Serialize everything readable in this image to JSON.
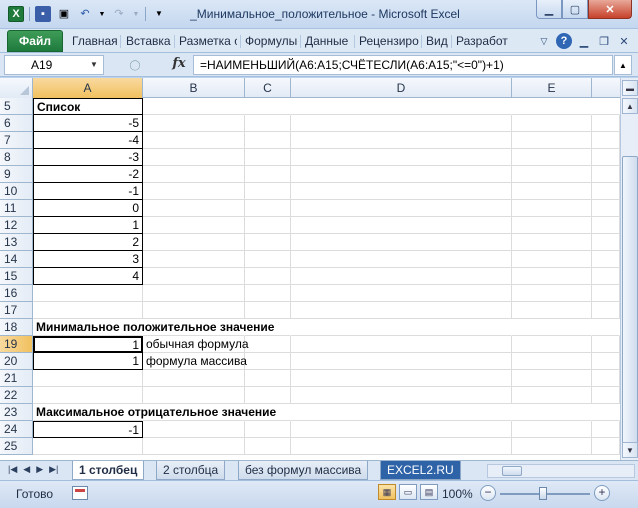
{
  "window": {
    "title": "_Минимальное_положительное  -  Microsoft Excel",
    "icons": [
      "excel-logo",
      "save",
      "save-as",
      "undo",
      "redo",
      "customize-qat"
    ]
  },
  "ribbon": {
    "file_tab": "Файл",
    "tabs": [
      "Главная",
      "Вставка",
      "Разметка с",
      "Формулы",
      "Данные",
      "Рецензиро",
      "Вид",
      "Разработ"
    ]
  },
  "formula_bar": {
    "name_box": "A19",
    "fx": "fx",
    "formula": "=НАИМЕНЬШИЙ(A6:A15;СЧЁТЕСЛИ(A6:A15;\"<=0\")+1)"
  },
  "grid": {
    "columns": [
      "A",
      "B",
      "C",
      "D",
      "E"
    ],
    "selected_column": "A",
    "selected_row": "19",
    "rows": [
      {
        "n": "5",
        "a": "Список",
        "a_bold": true
      },
      {
        "n": "6",
        "a": "-5"
      },
      {
        "n": "7",
        "a": "-4"
      },
      {
        "n": "8",
        "a": "-3"
      },
      {
        "n": "9",
        "a": "-2"
      },
      {
        "n": "10",
        "a": "-1"
      },
      {
        "n": "11",
        "a": "0"
      },
      {
        "n": "12",
        "a": "1"
      },
      {
        "n": "13",
        "a": "2"
      },
      {
        "n": "14",
        "a": "3"
      },
      {
        "n": "15",
        "a": "4"
      },
      {
        "n": "16",
        "a": ""
      },
      {
        "n": "17",
        "a": ""
      },
      {
        "n": "18",
        "a": "Минимальное положительное значение",
        "a_bold": true
      },
      {
        "n": "19",
        "a": "1",
        "b": "обычная формула"
      },
      {
        "n": "20",
        "a": "1",
        "b": "формула массива"
      },
      {
        "n": "21",
        "a": ""
      },
      {
        "n": "22",
        "a": ""
      },
      {
        "n": "23",
        "a": "Максимальное отрицательное значение",
        "a_bold": true
      },
      {
        "n": "24",
        "a": "-1"
      },
      {
        "n": "25",
        "a": ""
      }
    ]
  },
  "sheets": {
    "tabs": [
      "1 столбец",
      "2 столбца",
      "без формул массива",
      "EXCEL2.RU"
    ],
    "active": "1 столбец"
  },
  "status": {
    "ready": "Готово",
    "zoom": "100%"
  }
}
